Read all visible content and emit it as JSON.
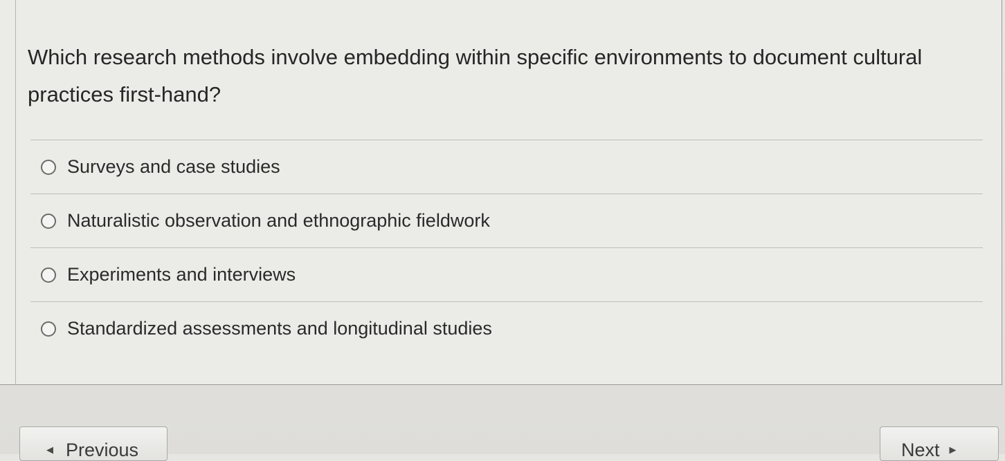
{
  "question": {
    "text": "Which research methods involve embedding within specific environments to document cultural practices first-hand?"
  },
  "options": [
    {
      "label": "Surveys and case studies",
      "selected": false
    },
    {
      "label": "Naturalistic observation and ethnographic fieldwork",
      "selected": false
    },
    {
      "label": "Experiments and interviews",
      "selected": false
    },
    {
      "label": "Standardized assessments and longitudinal studies",
      "selected": false
    }
  ],
  "navigation": {
    "previous_label": "Previous",
    "next_label": "Next",
    "previous_icon": "caret-left-icon",
    "next_icon": "caret-right-icon"
  }
}
